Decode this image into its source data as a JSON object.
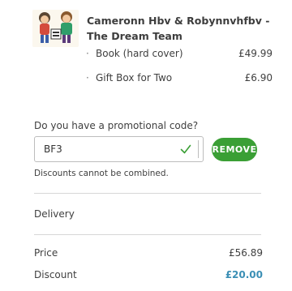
{
  "product": {
    "title": "Cameronn Hbv & Robynnvhfbv - The Dream Team",
    "lines": [
      {
        "bullet": "·",
        "name": "Book (hard cover)",
        "price": "£49.99"
      },
      {
        "bullet": "·",
        "name": "Gift Box for Two",
        "price": "£6.90"
      }
    ]
  },
  "promo": {
    "label": "Do you have a promotional code?",
    "code": "BF3",
    "remove_label": "REMOVE",
    "note": "Discounts cannot be combined."
  },
  "delivery": {
    "label": "Delivery"
  },
  "summary": {
    "price_label": "Price",
    "price_value": "£56.89",
    "discount_label": "Discount",
    "discount_value": "£20.00"
  },
  "colors": {
    "accent_green": "#3a9f35",
    "discount_blue": "#3b8fb5"
  }
}
